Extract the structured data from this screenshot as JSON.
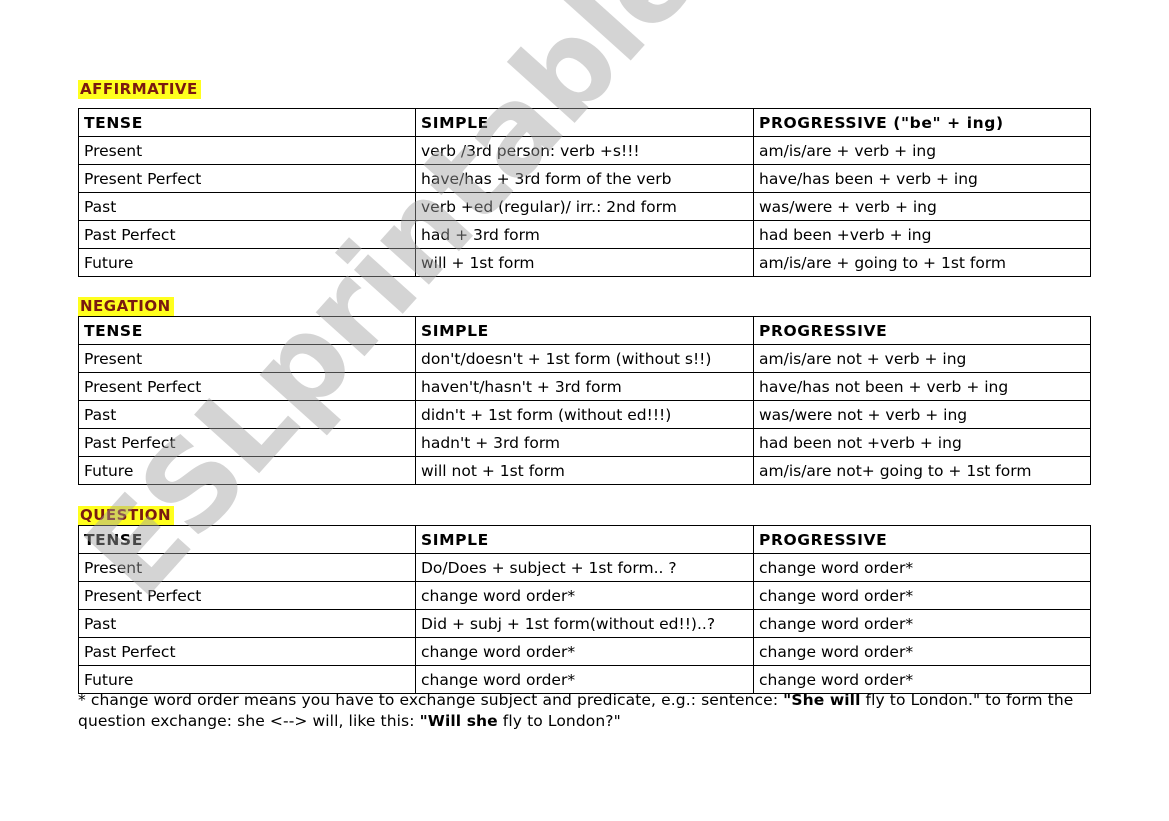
{
  "sections": [
    {
      "heading": "AFFIRMATIVE",
      "headers": [
        "TENSE",
        "SIMPLE",
        "PROGRESSIVE (\"be\" + ing)"
      ],
      "rows": [
        [
          "Present",
          "verb /3rd person: verb +s!!!",
          "am/is/are + verb + ing"
        ],
        [
          "Present Perfect",
          "have/has + 3rd form of the verb",
          "have/has been + verb + ing"
        ],
        [
          "Past",
          "verb +ed (regular)/ irr.: 2nd form",
          "was/were + verb + ing"
        ],
        [
          "Past Perfect",
          "had + 3rd form",
          "had been +verb + ing"
        ],
        [
          "Future",
          "will + 1st form",
          "am/is/are + going to + 1st form"
        ]
      ]
    },
    {
      "heading": "NEGATION",
      "headers": [
        "TENSE",
        "SIMPLE",
        "PROGRESSIVE"
      ],
      "rows": [
        [
          "Present",
          "don't/doesn't + 1st form (without s!!)",
          "am/is/are not + verb + ing"
        ],
        [
          "Present Perfect",
          "haven't/hasn't + 3rd form",
          "have/has not been + verb + ing"
        ],
        [
          "Past",
          "didn't + 1st form (without ed!!!)",
          "was/were not + verb + ing"
        ],
        [
          "Past Perfect",
          "hadn't + 3rd form",
          "had been not +verb + ing"
        ],
        [
          "Future",
          "will not + 1st form",
          "am/is/are not+ going to + 1st form"
        ]
      ]
    },
    {
      "heading": "QUESTION",
      "headers": [
        "TENSE",
        "SIMPLE",
        "PROGRESSIVE"
      ],
      "rows": [
        [
          "Present",
          "Do/Does + subject + 1st form.. ?",
          "change word order*"
        ],
        [
          "Present Perfect",
          "change word order*",
          "change word order*"
        ],
        [
          "Past",
          "Did + subj + 1st form(without ed!!)..?",
          "change word order*"
        ],
        [
          "Past Perfect",
          "change word order*",
          "change word order*"
        ],
        [
          "Future",
          "change word order*",
          "change word order*"
        ]
      ]
    }
  ],
  "footnote": {
    "part1": "* change word order means you have to exchange subject and predicate, e.g.: sentence: ",
    "bold1": "\"She will",
    "part2": " fly to London.\"  to form the question exchange: she <--> will, like this:  ",
    "bold2": "\"Will she",
    "part3": " fly to London?\""
  },
  "watermark": "ESLprintables.com",
  "colors": {
    "heading_highlight": "#ffff1e",
    "heading_text": "#7a1a10"
  }
}
